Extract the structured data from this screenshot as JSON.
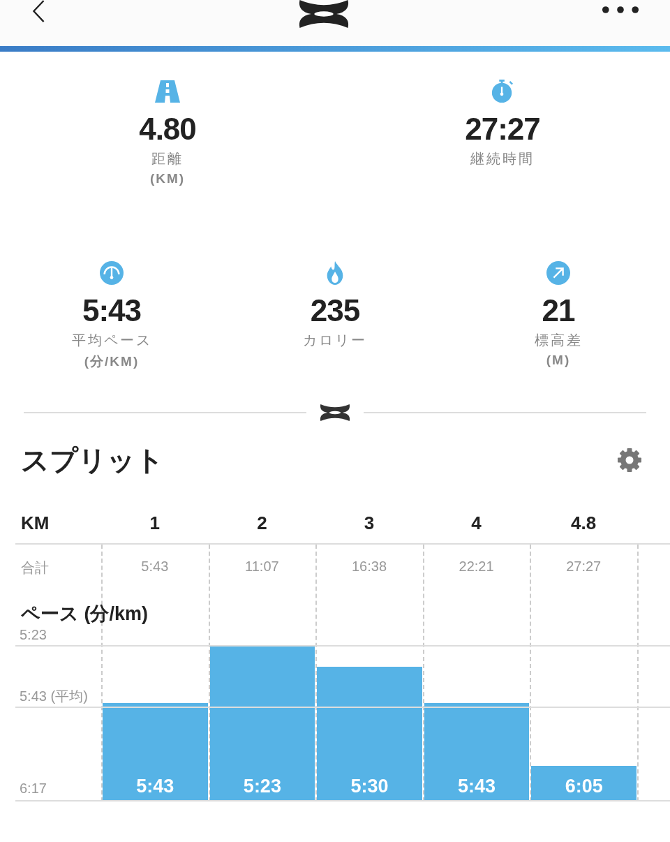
{
  "stats_rows": [
    [
      {
        "kind": "distance",
        "value": "4.80",
        "label": "距離",
        "unit": "(KM)"
      },
      {
        "kind": "duration",
        "value": "27:27",
        "label": "継続時間"
      }
    ],
    [
      {
        "kind": "pace",
        "value": "5:43",
        "label": "平均ペース",
        "unit": "(分/KM)"
      },
      {
        "kind": "calories",
        "value": "235",
        "label": "カロリー"
      },
      {
        "kind": "elevation",
        "value": "21",
        "label": "標高差",
        "unit": "(M)"
      }
    ]
  ],
  "splits": {
    "title": "スプリット",
    "header": [
      "KM",
      "1",
      "2",
      "3",
      "4",
      "4.8"
    ],
    "totals_label": "合計",
    "totals": [
      "5:43",
      "11:07",
      "16:38",
      "22:21",
      "27:27"
    ],
    "pace": {
      "title": "ペース (分/km)",
      "axis_labels": [
        "5:23",
        "5:43 (平均)",
        "6:17"
      ],
      "bars": [
        {
          "label": "5:43"
        },
        {
          "label": "5:23"
        },
        {
          "label": "5:30"
        },
        {
          "label": "5:43"
        },
        {
          "label": "6:05"
        }
      ]
    }
  }
}
